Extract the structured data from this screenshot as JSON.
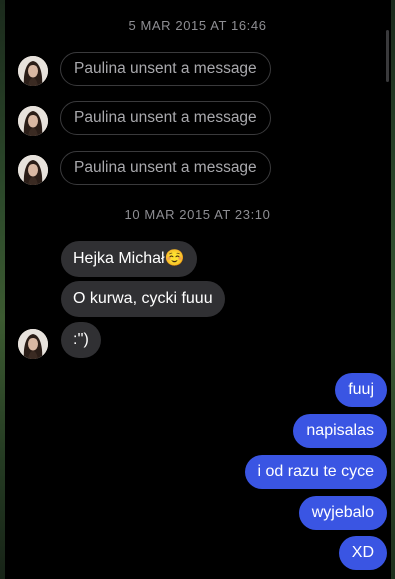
{
  "conversation": {
    "timestamps": [
      "5 MAR 2015 AT 16:46",
      "10 MAR 2015 AT 23:10"
    ],
    "unsent_notices": [
      "Paulina unsent a message",
      "Paulina unsent a message",
      "Paulina unsent a message"
    ],
    "incoming_messages": [
      "Hejka Michał☺️",
      "O kurwa, cycki fuuu",
      ":'')"
    ],
    "outgoing_messages": [
      "fuuj",
      "napisalas",
      "i od razu te cyce",
      "wyjebalo",
      "XD"
    ]
  },
  "colors": {
    "background": "#000000",
    "incoming_bubble": "#303033",
    "outgoing_bubble": "#3a55e3",
    "timestamp_text": "#8e8e93",
    "unsent_text": "#a9a9ad",
    "unsent_border": "#3a3a3c"
  },
  "icons": {
    "avatar": "contact-photo"
  }
}
